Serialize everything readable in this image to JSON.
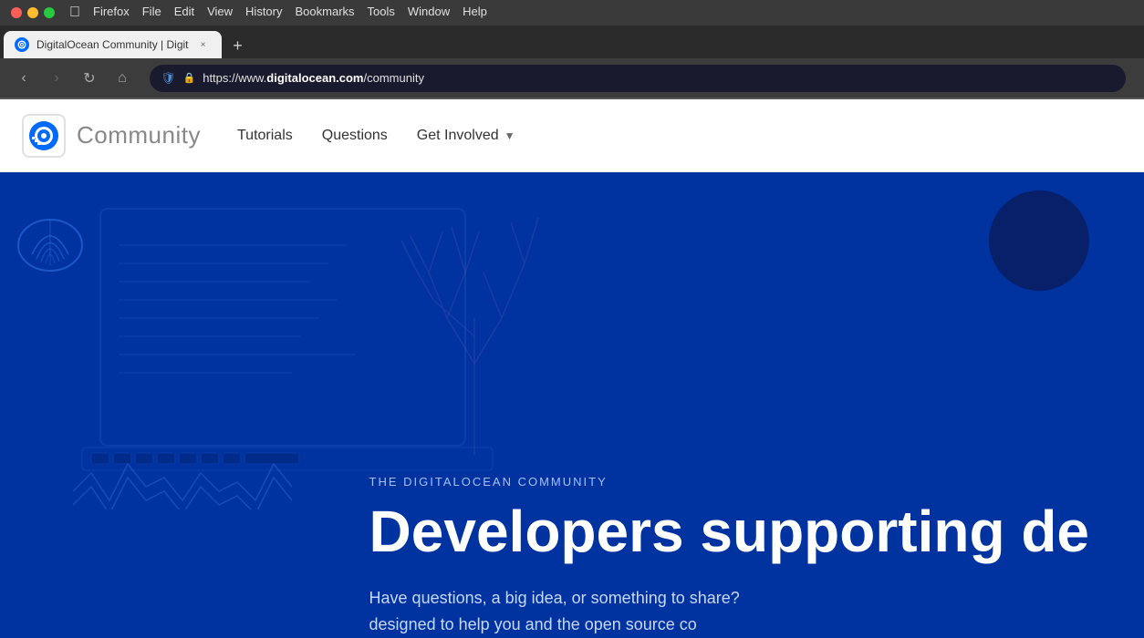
{
  "os": {
    "apple_label": "",
    "menu_items": [
      "Firefox",
      "File",
      "Edit",
      "View",
      "History",
      "Bookmarks",
      "Tools",
      "Window",
      "Help"
    ]
  },
  "browser": {
    "tab": {
      "title": "DigitalOcean Community | Digit",
      "close_icon": "×"
    },
    "new_tab_icon": "+",
    "nav": {
      "back_icon": "‹",
      "forward_icon": "›",
      "reload_icon": "↻",
      "home_icon": "⌂",
      "shield_icon": "🛡",
      "lock_icon": "🔒",
      "url_prefix": "https://www.",
      "url_domain": "digitalocean.com",
      "url_path": "/community"
    }
  },
  "website": {
    "nav": {
      "logo_text": "Community",
      "links": [
        {
          "label": "Tutorials",
          "has_arrow": false
        },
        {
          "label": "Questions",
          "has_arrow": false
        },
        {
          "label": "Get Involved",
          "has_arrow": true
        }
      ]
    },
    "hero": {
      "subtitle": "THE DIGITALOCEAN COMMUNITY",
      "title": "Developers supporting de",
      "description_line1": "Have questions, a big idea, or something to share?",
      "description_line2": "designed to help you and the open source co"
    }
  },
  "colors": {
    "hero_bg": "#0033a0",
    "tab_bg": "#f0f0f0",
    "address_bg": "#1a1a2e"
  }
}
